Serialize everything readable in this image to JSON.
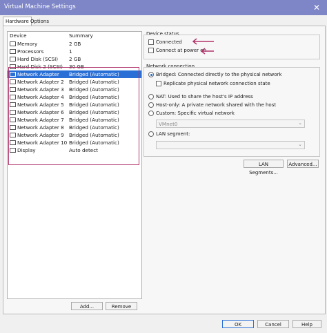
{
  "window": {
    "title": "Virtual Machine Settings",
    "close_glyph": "✕"
  },
  "tabs": [
    {
      "label": "Hardware"
    },
    {
      "label": "Options"
    }
  ],
  "device_list": {
    "headers": {
      "device": "Device",
      "summary": "Summary"
    },
    "rows": [
      {
        "icon": "memory-icon",
        "device": "Memory",
        "summary": "2 GB"
      },
      {
        "icon": "processor-icon",
        "device": "Processors",
        "summary": "1"
      },
      {
        "icon": "disk-icon",
        "device": "Hard Disk (SCSI)",
        "summary": "2 GB"
      },
      {
        "icon": "disk-icon",
        "device": "Hard Disk 2 (SCSI)",
        "summary": "30 GB"
      },
      {
        "icon": "network-adapter-icon",
        "device": "Network Adapter",
        "summary": "Bridged (Automatic)",
        "selected": true
      },
      {
        "icon": "network-adapter-icon",
        "device": "Network Adapter 2",
        "summary": "Bridged (Automatic)"
      },
      {
        "icon": "network-adapter-icon",
        "device": "Network Adapter 3",
        "summary": "Bridged (Automatic)"
      },
      {
        "icon": "network-adapter-icon",
        "device": "Network Adapter 4",
        "summary": "Bridged (Automatic)"
      },
      {
        "icon": "network-adapter-icon",
        "device": "Network Adapter 5",
        "summary": "Bridged (Automatic)"
      },
      {
        "icon": "network-adapter-icon",
        "device": "Network Adapter 6",
        "summary": "Bridged (Automatic)"
      },
      {
        "icon": "network-adapter-icon",
        "device": "Network Adapter 7",
        "summary": "Bridged (Automatic)"
      },
      {
        "icon": "network-adapter-icon",
        "device": "Network Adapter 8",
        "summary": "Bridged (Automatic)"
      },
      {
        "icon": "network-adapter-icon",
        "device": "Network Adapter 9",
        "summary": "Bridged (Automatic)"
      },
      {
        "icon": "network-adapter-icon",
        "device": "Network Adapter 10",
        "summary": "Bridged (Automatic)"
      },
      {
        "icon": "display-icon",
        "device": "Display",
        "summary": "Auto detect"
      }
    ],
    "add_label": "Add...",
    "remove_label": "Remove"
  },
  "device_status": {
    "title": "Device status",
    "connected": {
      "label": "Connected",
      "checked": false
    },
    "connect_at_power_on": {
      "label": "Connect at power on",
      "checked": false
    }
  },
  "network_connection": {
    "title": "Network connection",
    "bridged": "Bridged: Connected directly to the physical network",
    "replicate": "Replicate physical network connection state",
    "nat": "NAT: Used to share the host's IP address",
    "host_only": "Host-only: A private network shared with the host",
    "custom": "Custom: Specific virtual network",
    "custom_value": "VMnet0",
    "lan_segment": "LAN segment:",
    "lan_segment_value": "",
    "selected": "bridged"
  },
  "net_buttons": {
    "lan_segments": "LAN Segments...",
    "advanced": "Advanced..."
  },
  "footer": {
    "ok": "OK",
    "cancel": "Cancel",
    "help": "Help"
  },
  "colors": {
    "titlebar": "#7e86c7",
    "selection": "#2a6fd6",
    "annotation": "#b0336b"
  }
}
